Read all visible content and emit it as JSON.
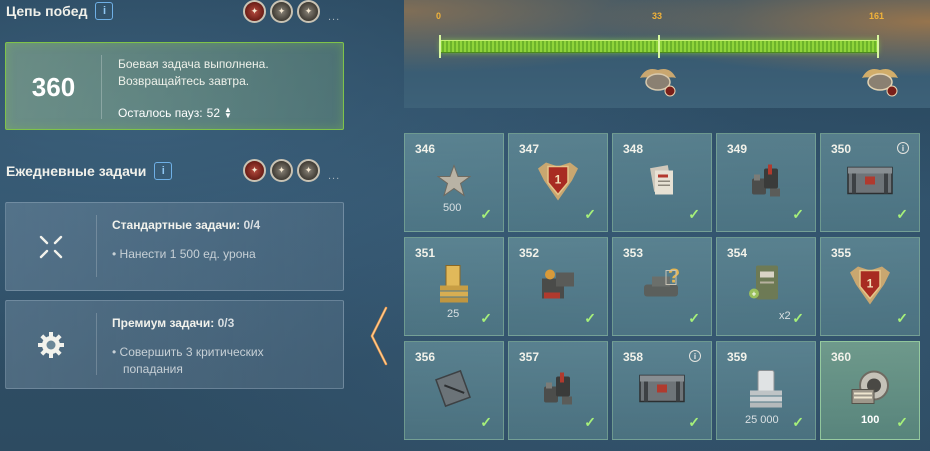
{
  "chain": {
    "title": "Цепь побед",
    "info_icon": "i",
    "medal_count_dots": "...",
    "value": "360",
    "line1": "Боевая задача выполнена.",
    "line2": "Возвращайтесь завтра.",
    "pause_label": "Осталось пауз:",
    "pause_value": "52"
  },
  "daily": {
    "title": "Ежедневные задачи",
    "info_icon": "i",
    "medal_count_dots": "...",
    "standard": {
      "title": "Стандартные задачи:",
      "count": "0/4",
      "item": "• Нанести 1 500 ед. урона"
    },
    "premium": {
      "title": "Премиум задачи:",
      "count": "0/3",
      "item_l1": "• Совершить 3 критических",
      "item_l2": "попадания"
    }
  },
  "progress": {
    "ticks": [
      "0",
      "33",
      "161"
    ],
    "fill_fraction": 1.0,
    "colors": {
      "fill": "#8fd43a",
      "tick": "#f0b23a"
    }
  },
  "rewards": [
    {
      "num": "346",
      "icon": "star-icon",
      "qty": "500",
      "done": true,
      "info": false
    },
    {
      "num": "347",
      "icon": "shield-rank-icon",
      "qty": "",
      "done": true,
      "info": false
    },
    {
      "num": "348",
      "icon": "documents-icon",
      "qty": "",
      "done": true,
      "info": false
    },
    {
      "num": "349",
      "icon": "equipment-icon",
      "qty": "",
      "done": true,
      "info": false
    },
    {
      "num": "350",
      "icon": "crate-icon",
      "qty": "",
      "done": true,
      "info": true
    },
    {
      "num": "351",
      "icon": "gold-icon",
      "qty": "25",
      "done": true,
      "info": false
    },
    {
      "num": "352",
      "icon": "directive-icon",
      "qty": "",
      "done": true,
      "info": false
    },
    {
      "num": "353",
      "icon": "mystery-tank-icon",
      "qty": "",
      "done": true,
      "info": false
    },
    {
      "num": "354",
      "icon": "booster-icon",
      "qty": "x2",
      "done": true,
      "info": false
    },
    {
      "num": "355",
      "icon": "shield-rank-icon",
      "qty": "",
      "done": true,
      "info": false
    },
    {
      "num": "356",
      "icon": "manual-icon",
      "qty": "",
      "done": true,
      "info": false
    },
    {
      "num": "357",
      "icon": "equipment-icon",
      "qty": "",
      "done": true,
      "info": false
    },
    {
      "num": "358",
      "icon": "crate-icon",
      "qty": "",
      "done": true,
      "info": true
    },
    {
      "num": "359",
      "icon": "silver-icon",
      "qty": "25 000",
      "done": true,
      "info": false
    },
    {
      "num": "360",
      "icon": "bonds-icon",
      "qty": "100",
      "done": true,
      "info": false,
      "current": true
    }
  ],
  "check_glyph": "✓"
}
